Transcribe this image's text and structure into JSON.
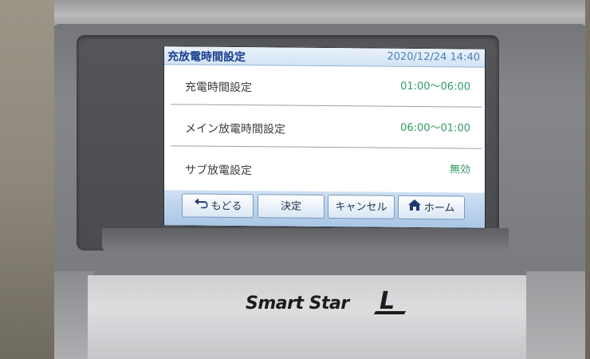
{
  "screen": {
    "title": "充放電時間設定",
    "datetime": "2020/12/24  14:40"
  },
  "settings": [
    {
      "label": "充電時間設定",
      "value": "01:00〜06:00"
    },
    {
      "label": "メイン放電時間設定",
      "value": "06:00〜01:00"
    },
    {
      "label": "サブ放電設定",
      "value": "無効"
    }
  ],
  "buttons": {
    "back": "もどる",
    "confirm": "決定",
    "cancel": "キャンセル",
    "home": "ホーム"
  },
  "device": {
    "brand": "Smart Star",
    "brand_suffix": "L"
  },
  "colors": {
    "title_text": "#1b3f8f",
    "value_text": "#2f9a62",
    "button_bar": "#a9c6e6"
  }
}
